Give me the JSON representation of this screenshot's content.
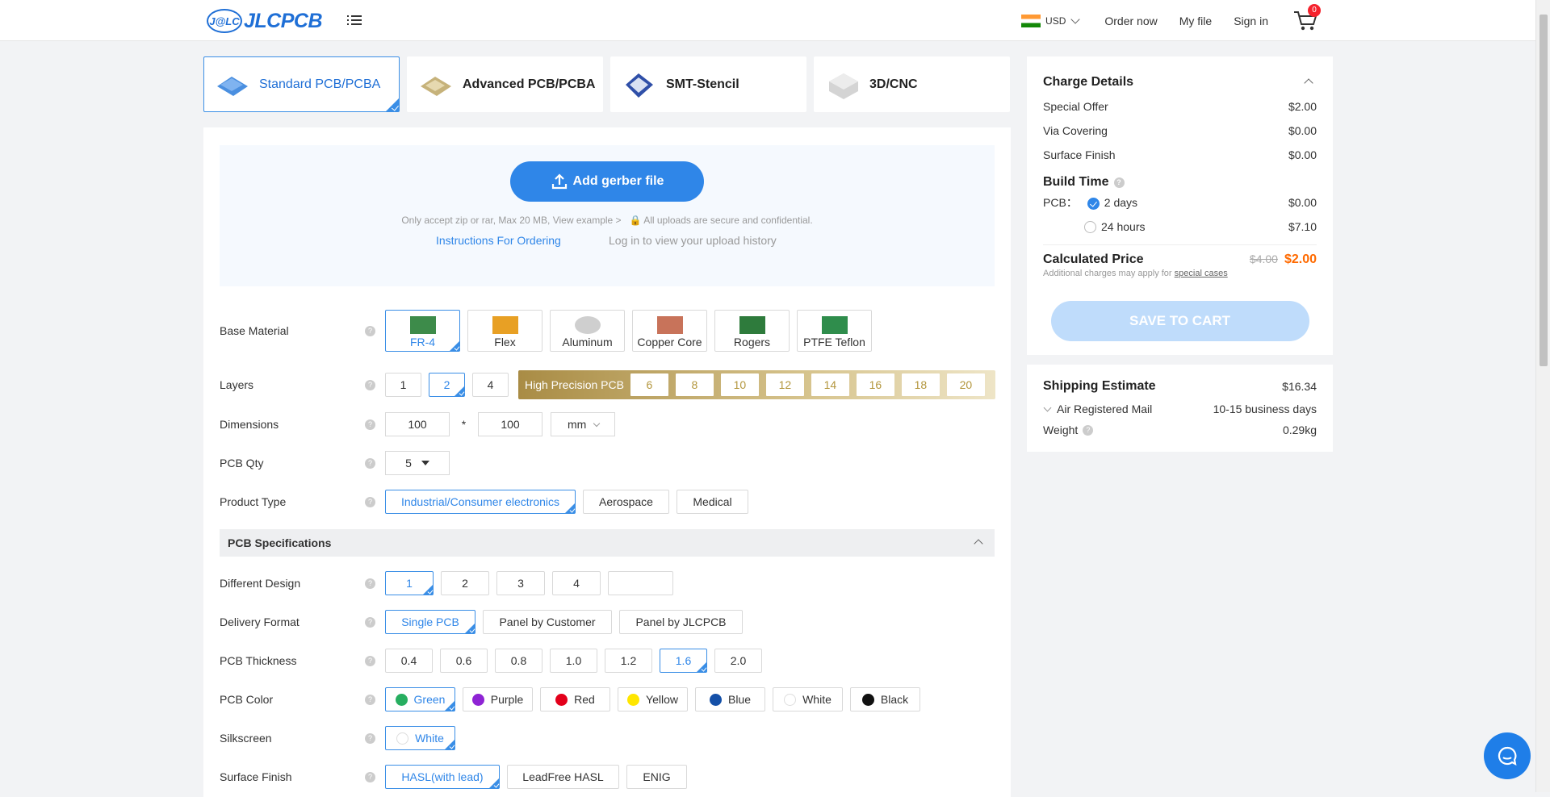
{
  "header": {
    "logo_mark": "J@LC",
    "logo_text": "JLCPCB",
    "currency": "USD",
    "links": [
      "Order now",
      "My file",
      "Sign in"
    ],
    "cart_count": "0"
  },
  "tabs": [
    "Standard PCB/PCBA",
    "Advanced PCB/PCBA",
    "SMT-Stencil",
    "3D/CNC"
  ],
  "upload": {
    "button": "Add gerber file",
    "note": "Only accept zip or rar, Max 20 MB, View example >",
    "secure": "All uploads are secure and confidential.",
    "instructions": "Instructions For Ordering",
    "history": "Log in to view your upload history"
  },
  "form": {
    "base_material": {
      "label": "Base Material",
      "options": [
        "FR-4",
        "Flex",
        "Aluminum",
        "Copper Core",
        "Rogers",
        "PTFE Teflon"
      ]
    },
    "layers": {
      "label": "Layers",
      "options": [
        "1",
        "2",
        "4"
      ],
      "hp_label": "High Precision PCB",
      "hp_options": [
        "6",
        "8",
        "10",
        "12",
        "14",
        "16",
        "18",
        "20"
      ]
    },
    "dimensions": {
      "label": "Dimensions",
      "w": "100",
      "sep": "*",
      "h": "100",
      "unit": "mm"
    },
    "qty": {
      "label": "PCB Qty",
      "value": "5"
    },
    "product_type": {
      "label": "Product Type",
      "options": [
        "Industrial/Consumer electronics",
        "Aerospace",
        "Medical"
      ]
    },
    "spec_title": "PCB Specifications",
    "different_design": {
      "label": "Different Design",
      "options": [
        "1",
        "2",
        "3",
        "4"
      ]
    },
    "delivery": {
      "label": "Delivery Format",
      "options": [
        "Single PCB",
        "Panel by Customer",
        "Panel by JLCPCB"
      ]
    },
    "thickness": {
      "label": "PCB Thickness",
      "options": [
        "0.4",
        "0.6",
        "0.8",
        "1.0",
        "1.2",
        "1.6",
        "2.0"
      ]
    },
    "color": {
      "label": "PCB Color",
      "options": [
        "Green",
        "Purple",
        "Red",
        "Yellow",
        "Blue",
        "White",
        "Black"
      ],
      "swatches": [
        "#27ae60",
        "#8e24d4",
        "#e3001b",
        "#ffe600",
        "#1450a8",
        "#ffffff",
        "#111111"
      ]
    },
    "silkscreen": {
      "label": "Silkscreen",
      "options": [
        "White"
      ]
    },
    "surface": {
      "label": "Surface Finish",
      "options": [
        "HASL(with lead)",
        "LeadFree HASL",
        "ENIG"
      ]
    }
  },
  "charge": {
    "title": "Charge Details",
    "items": [
      {
        "name": "Special Offer",
        "value": "$2.00"
      },
      {
        "name": "Via Covering",
        "value": "$0.00"
      },
      {
        "name": "Surface Finish",
        "value": "$0.00"
      }
    ],
    "build_title": "Build Time",
    "pcb_label": "PCB：",
    "build_options": [
      {
        "name": "2 days",
        "value": "$0.00"
      },
      {
        "name": "24 hours",
        "value": "$7.10"
      }
    ],
    "calc_title": "Calculated Price",
    "old_price": "$4.00",
    "new_price": "$2.00",
    "note": "Additional charges may apply for",
    "note_link": "special cases",
    "save": "SAVE TO CART"
  },
  "shipping": {
    "title": "Shipping Estimate",
    "price": "$16.34",
    "method": "Air Registered Mail",
    "days": "10-15 business days",
    "weight_label": "Weight",
    "weight": "0.29kg"
  },
  "colors": {
    "accent": "#2f86e8",
    "price": "#ff6a00"
  }
}
